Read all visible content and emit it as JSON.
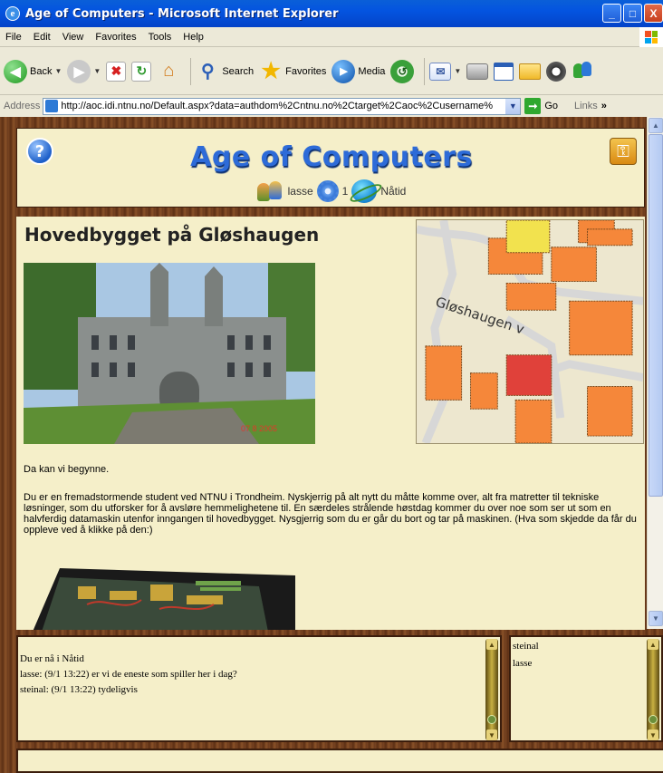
{
  "window": {
    "title": "Age of Computers - Microsoft Internet Explorer",
    "minimize": "_",
    "maximize": "□",
    "close": "X"
  },
  "menu": [
    "File",
    "Edit",
    "View",
    "Favorites",
    "Tools",
    "Help"
  ],
  "toolbar": {
    "back": "Back",
    "search": "Search",
    "favorites": "Favorites",
    "media": "Media"
  },
  "address": {
    "label": "Address",
    "url": "http://aoc.idi.ntnu.no/Default.aspx?data=authdom%2Cntnu.no%2Ctarget%2Caoc%2Cusername%",
    "go": "Go",
    "links": "Links",
    "links_chevron": "»"
  },
  "header": {
    "title": "Age of Computers",
    "username": "lasse",
    "level": "1",
    "era": "Nåtid"
  },
  "content": {
    "place_title": "Hovedbygget på Gløshaugen",
    "map_label": "Gløshaugen v",
    "photo_date": "07  8 2005",
    "intro": "Da kan vi begynne.",
    "story": "Du er en fremadstormende student ved NTNU i Trondheim. Nyskjerrig på alt nytt du måtte komme over, alt fra matretter til tekniske løsninger, som du utforsker for å avsløre hemmelighetene til. En særdeles strålende høstdag kommer du over noe som ser ut som en halvferdig datamaskin utenfor inngangen til hovedbygget. Nysgjerrig som du er går du bort og tar på maskinen. (Hva som skjedde da får du oppleve ved å klikke på den:)"
  },
  "chat": {
    "messages": [
      "Du er nå i Nåtid",
      "lasse: (9/1 13:22) er vi de eneste som spiller her i dag?",
      "steinal: (9/1 13:22) tydeligvis"
    ],
    "users": [
      "steinal",
      "lasse"
    ]
  },
  "colors": {
    "panel_bg": "#f5efc9",
    "title_blue": "#2d6bd8",
    "wood": "#6b3a1d"
  }
}
